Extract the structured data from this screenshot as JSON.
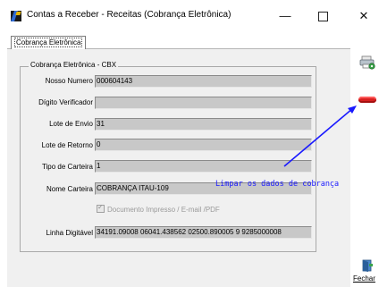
{
  "window": {
    "title": "Contas a Receber - Receitas (Cobrança Eletrônica)",
    "minimize": "—",
    "close": "✕"
  },
  "tab": {
    "label": "Cobrança Eletrônica"
  },
  "group": {
    "title": "Cobrança Eletrônica - CBX"
  },
  "fields": {
    "nosso_numero": {
      "label": "Nosso Numero",
      "value": "000604143"
    },
    "digito_verificador": {
      "label": "Dígito Verificador",
      "value": ""
    },
    "lote_envio": {
      "label": "Lote de Envio",
      "value": "31"
    },
    "lote_retorno": {
      "label": "Lote de Retorno",
      "value": "0"
    },
    "tipo_carteira": {
      "label": "Tipo de Carteira",
      "value": "1"
    },
    "nome_carteira": {
      "label": "Nome Carteira",
      "value": "COBRANÇA ITAU-109"
    },
    "linha_digitavel": {
      "label": "Linha Digitável",
      "value": "34191.09008 06041.438562 02500.890005 9 9285000008"
    }
  },
  "checkbox": {
    "label": "Documento Impresso / E-mail /PDF",
    "checked": true
  },
  "toolbar": {
    "tool_icon": "printer-gear-icon",
    "clear_icon": "red-minus-icon",
    "close_icon": "exit-door-icon",
    "close_label": "Fechar"
  },
  "annotation": {
    "text": "Limpar os dados de cobrança",
    "color": "#1a1aff"
  }
}
